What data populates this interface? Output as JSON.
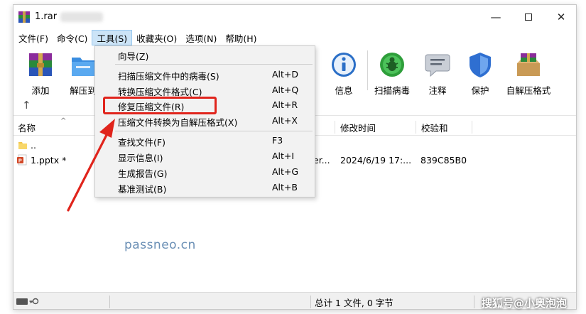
{
  "window": {
    "title": "1.rar",
    "controls": {
      "minimize": "—",
      "maximize": "",
      "close": "✕"
    }
  },
  "menubar": {
    "items": [
      {
        "label": "文件(F)"
      },
      {
        "label": "命令(C)"
      },
      {
        "label": "工具(S)",
        "active": true
      },
      {
        "label": "收藏夹(O)"
      },
      {
        "label": "选项(N)"
      },
      {
        "label": "帮助(H)"
      }
    ]
  },
  "toolbar": {
    "add": "添加",
    "extract": "解压到",
    "info": "信息",
    "scan": "扫描病毒",
    "comment": "注释",
    "protect": "保护",
    "sfx": "自解压格式"
  },
  "navrow": {
    "up_icon": "up-arrow-icon"
  },
  "list": {
    "columns": {
      "name": "名称",
      "modified": "修改时间",
      "checksum": "校验和"
    },
    "rows": [
      {
        "name": "..",
        "type_tail": "",
        "modified": "",
        "checksum": ""
      },
      {
        "name": "1.pptx *",
        "type_tail": "er...",
        "modified": "2024/6/19 17:...",
        "checksum": "839C85B0"
      }
    ]
  },
  "dropdown": {
    "items": [
      {
        "label": "向导(Z)",
        "shortcut": ""
      },
      {
        "label": "扫描压缩文件中的病毒(S)",
        "shortcut": "Alt+D"
      },
      {
        "label": "转换压缩文件格式(C)",
        "shortcut": "Alt+Q"
      },
      {
        "label": "修复压缩文件(R)",
        "shortcut": "Alt+R",
        "highlighted": true
      },
      {
        "label": "压缩文件转换为自解压格式(X)",
        "shortcut": "Alt+X"
      },
      {
        "label": "查找文件(F)",
        "shortcut": "F3"
      },
      {
        "label": "显示信息(I)",
        "shortcut": "Alt+I"
      },
      {
        "label": "生成报告(G)",
        "shortcut": "Alt+G"
      },
      {
        "label": "基准测试(B)",
        "shortcut": "Alt+B"
      }
    ]
  },
  "watermark": "passneo.cn",
  "statusbar": {
    "summary": "总计 1 文件, 0 字节"
  },
  "corner_watermark": "搜狐号@小奥泡泡",
  "colors": {
    "menu_active": "#cce4f7",
    "highlight_red": "#e0241c",
    "watermark_blue": "#6a8fb5"
  }
}
